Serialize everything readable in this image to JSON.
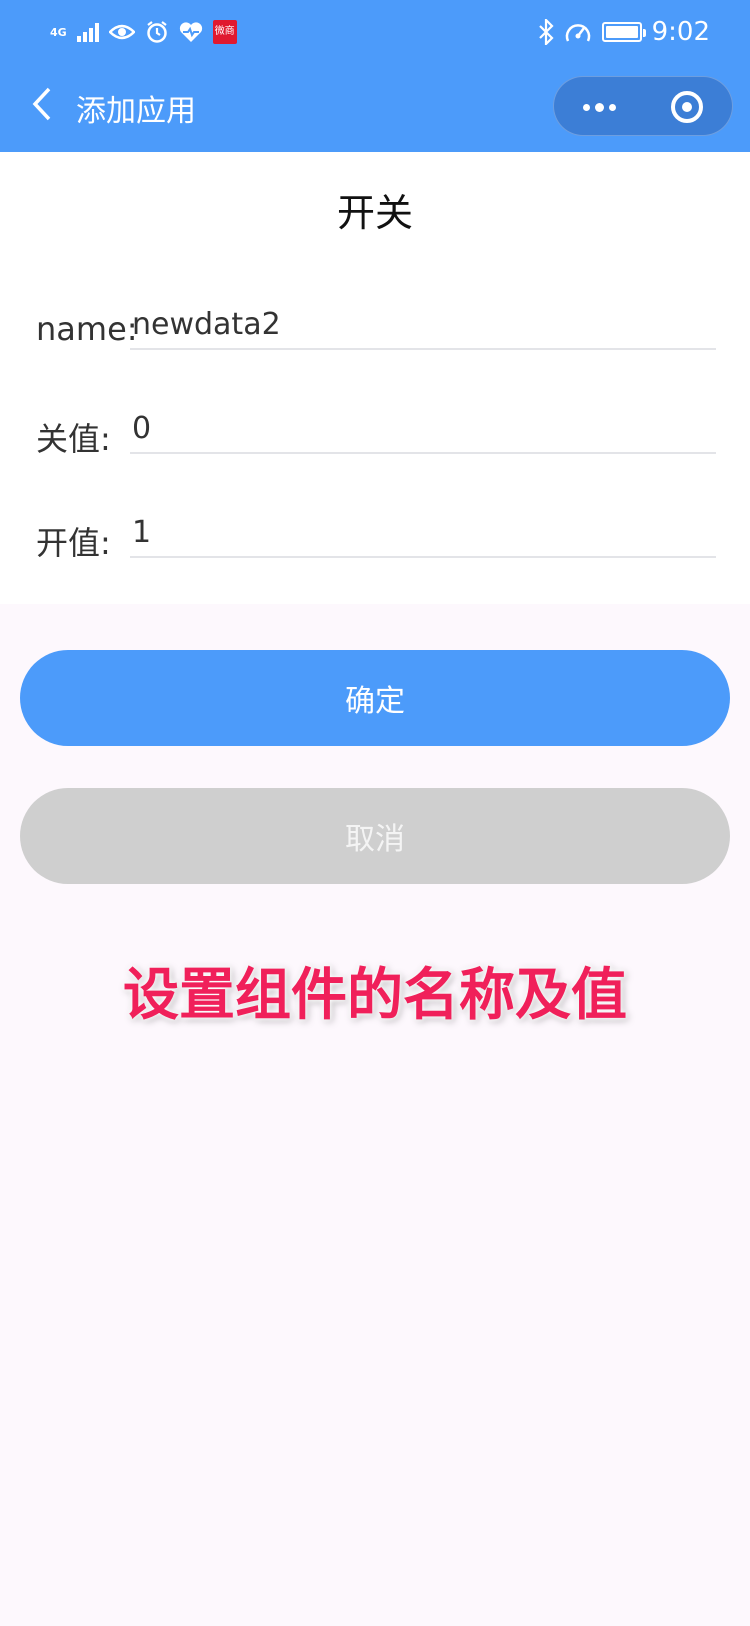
{
  "status_bar": {
    "signal_label": "4G",
    "time": "9:02",
    "app_badge_text": "微商",
    "icons": [
      "signal-icon",
      "eye-icon",
      "alarm-icon",
      "health-icon",
      "app-badge-icon",
      "bluetooth-icon",
      "speed-icon",
      "battery-icon"
    ]
  },
  "nav": {
    "title": "添加应用",
    "back_icon": "chevron-left-icon",
    "more_icon": "more-dots-icon",
    "close_icon": "target-ring-icon"
  },
  "form": {
    "title": "开关",
    "fields": [
      {
        "label": "name:",
        "value": "newdata2"
      },
      {
        "label": "关值:",
        "value": "0"
      },
      {
        "label": "开值:",
        "value": "1"
      }
    ]
  },
  "buttons": {
    "confirm": "确定",
    "cancel": "取消"
  },
  "colors": {
    "accent": "#4c9bfa",
    "cancel": "#cfcfcf",
    "caption": "#f0205a"
  },
  "caption": "设置组件的名称及值"
}
